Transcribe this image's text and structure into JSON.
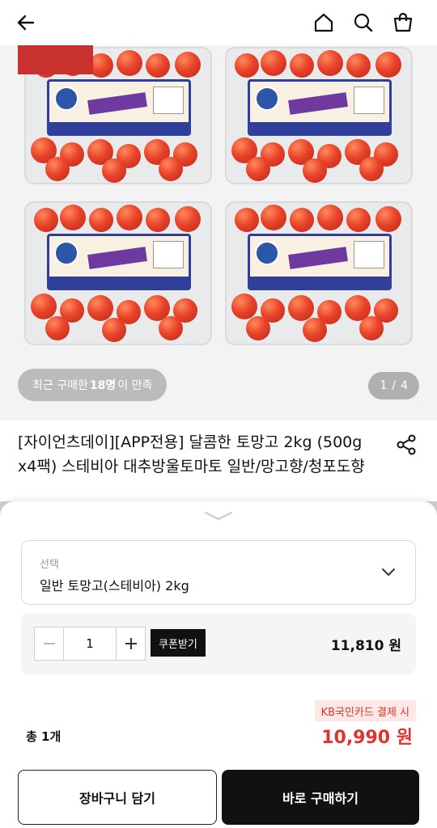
{
  "header": {
    "back_icon": "arrow-left-icon",
    "home_icon": "home-icon",
    "search_icon": "search-icon",
    "bag_icon": "shopping-bag-icon"
  },
  "gallery": {
    "recent_buyers_prefix": "최근 구매한 ",
    "recent_buyers_count": "18명",
    "recent_buyers_suffix": "이 만족",
    "pager_current": "1",
    "pager_separator": "/",
    "pager_total": "4"
  },
  "product": {
    "title": "[자이언츠데이][APP전용] 달콤한 토망고 2kg (500g x4팩) 스테비아 대추방울토마토 일반/망고향/청포도향",
    "share_icon": "share-icon"
  },
  "sheet": {
    "select_label": "선택",
    "select_value": "일반 토망고(스테비아) 2kg",
    "quantity": "1",
    "coupon_label": "쿠폰받기",
    "option_price": "11,810 원",
    "card_promo": "KB국민카드 결제 시",
    "total_label": "총 1개",
    "total_price": "10,990 원",
    "cart_button": "장바구니 담기",
    "buy_button": "바로 구매하기"
  },
  "colors": {
    "accent_red": "#e0332a",
    "ribbon": "#c8312e",
    "dark": "#111111"
  }
}
